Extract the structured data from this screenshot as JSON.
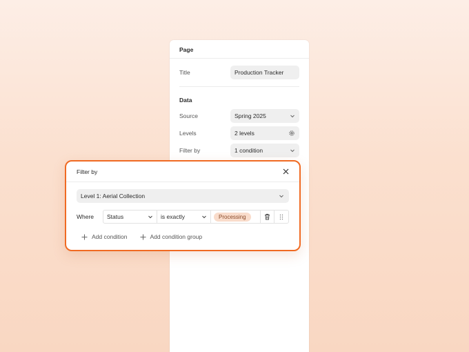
{
  "panel": {
    "header": "Page",
    "title_label": "Title",
    "title_value": "Production Tracker",
    "data_section": "Data",
    "source_label": "Source",
    "source_value": "Spring 2025",
    "levels_label": "Levels",
    "levels_value": "2 levels",
    "filter_label": "Filter by",
    "filter_value": "1 condition"
  },
  "filter_popover": {
    "title": "Filter by",
    "level_select": "Level 1: Aerial Collection",
    "where_label": "Where",
    "condition": {
      "field": "Status",
      "operator": "is exactly",
      "value": "Processing"
    },
    "add_condition": "Add condition",
    "add_condition_group": "Add condition group"
  },
  "colors": {
    "accent_border": "#f06a22",
    "tag_bg": "#f9dccb",
    "tag_text": "#8a4a2a"
  }
}
